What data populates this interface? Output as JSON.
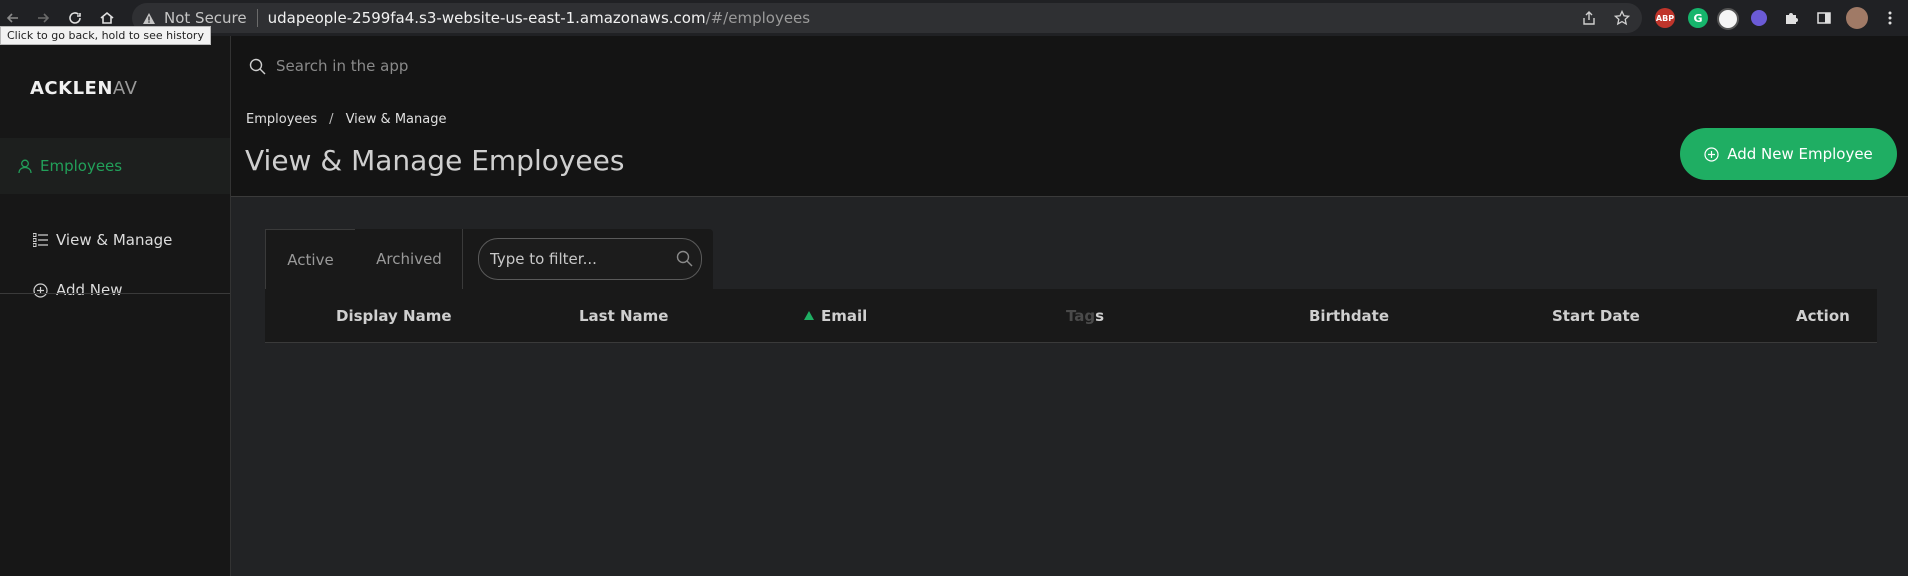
{
  "browser": {
    "security_label": "Not Secure",
    "url_host": "udapeople-2599fa4.s3-website-us-east-1.amazonaws.com",
    "url_path": "/#/employees",
    "tooltip": "Click to go back, hold to see history",
    "extensions": [
      "ABP",
      "G"
    ]
  },
  "sidebar": {
    "logo_main": "ACKLEN",
    "logo_fade": "AV",
    "section_label": "Employees",
    "items": [
      {
        "label": "View & Manage",
        "icon": "list-icon"
      },
      {
        "label": "Add New",
        "icon": "plus-circle-icon"
      }
    ]
  },
  "header": {
    "search_placeholder": "Search in the app",
    "breadcrumb": [
      "Employees",
      "View & Manage"
    ],
    "title": "View & Manage Employees",
    "add_button": "Add New Employee"
  },
  "tabs": [
    {
      "label": "Active",
      "active": true
    },
    {
      "label": "Archived",
      "active": false
    }
  ],
  "filter_placeholder": "Type to filter...",
  "table": {
    "columns": [
      "Display Name",
      "Last Name",
      "Email",
      "Tags",
      "Birthdate",
      "Start Date",
      "Action"
    ],
    "tags_dim_part": "Tag",
    "tags_bright_part": "s",
    "sorted_column": "Email",
    "sort_color": "#1fae63"
  },
  "colors": {
    "accent": "#1fae63",
    "sidebar_active": "#22a05a"
  }
}
